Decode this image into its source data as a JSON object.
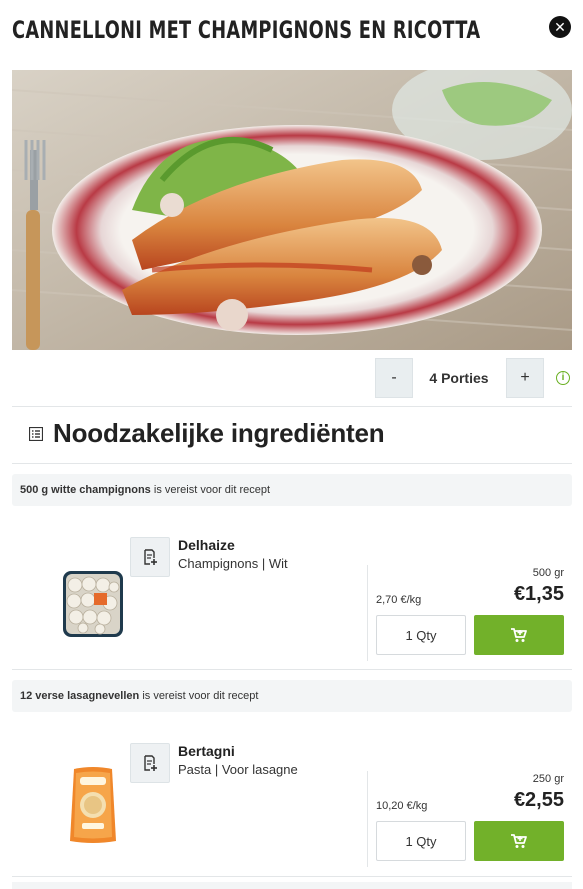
{
  "recipe": {
    "title": "Cannelloni met champignons en ricotta",
    "close_icon": "close-icon"
  },
  "portions": {
    "minus_label": "-",
    "count_label": "4 Porties",
    "plus_label": "+",
    "info_icon": "info-icon"
  },
  "ingredients_section": {
    "title": "Noodzakelijke ingrediënten",
    "icon": "list-icon"
  },
  "ingredients": [
    {
      "required_amount": "500 g witte champignons",
      "required_suffix": "is vereist voor dit recept",
      "product": {
        "brand": "Delhaize",
        "description": "Champignons | Wit",
        "weight": "500 gr",
        "unit_price": "2,70 €/kg",
        "price": "€1,35",
        "qty_label": "1 Qty"
      }
    },
    {
      "required_amount": "12 verse lasagnevellen",
      "required_suffix": "is vereist voor dit recept",
      "product": {
        "brand": "Bertagni",
        "description": "Pasta | Voor lasagne",
        "weight": "250 gr",
        "unit_price": "10,20 €/kg",
        "price": "€2,55",
        "qty_label": "1 Qty"
      }
    }
  ],
  "colors": {
    "accent_green": "#72b12a",
    "text_dark": "#222222",
    "panel_gray": "#f3f5f6"
  }
}
